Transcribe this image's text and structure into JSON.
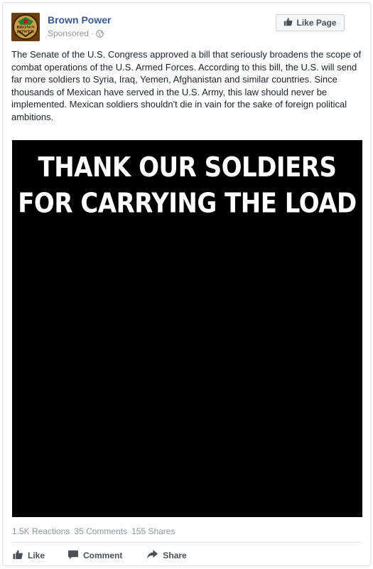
{
  "post": {
    "page_name": "Brown Power",
    "sponsored_label": "Sponsored",
    "separator": "·",
    "like_page_label": "Like Page",
    "logo_text": [
      "BROWN",
      "POWER"
    ],
    "text": "The Senate of the U.S. Congress approved a bill that seriously broadens the scope of combat operations of the U.S. Armed Forces. According to this bill, the U.S. will send far more soldiers to Syria, Iraq, Yemen, Afghanistan and similar countries. Since thousands of Mexican have served in the U.S. Army, this law should never be implemented. Mexican soldiers shouldn't die in vain for the sake of foreign political ambitions.",
    "image_caption": [
      "THANK OUR SOLDIERS",
      "FOR CARRYING THE LOAD"
    ]
  },
  "stats": {
    "reactions": "1.5K Reactions",
    "comments": "35 Comments",
    "shares": "155 Shares"
  },
  "actions": {
    "like": "Like",
    "comment": "Comment",
    "share": "Share"
  },
  "icons": {
    "globe": "globe-icon",
    "thumbs_up": "thumbs-up-icon",
    "comment": "comment-icon",
    "share": "share-arrow-icon"
  },
  "colors": {
    "page_name": "#365899",
    "meta": "#90949c",
    "text": "#1d2129"
  }
}
